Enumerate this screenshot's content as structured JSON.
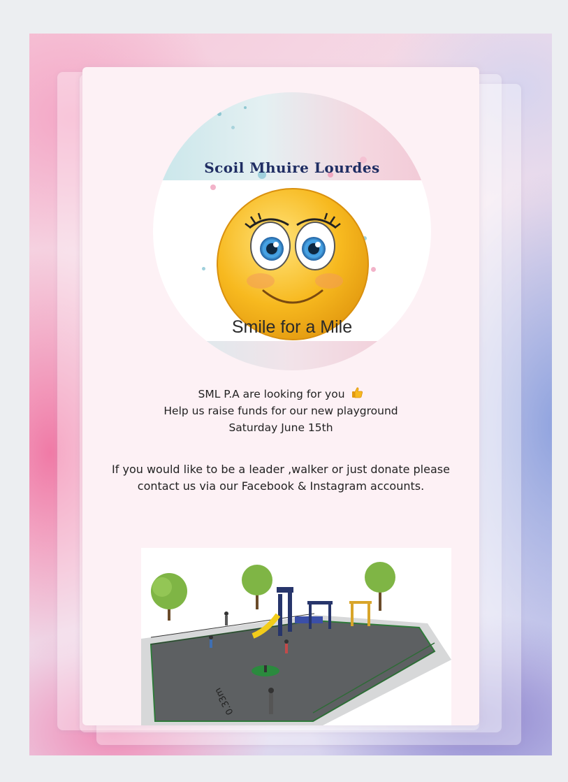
{
  "logo": {
    "school_name": "Scoil Mhuire Lourdes",
    "event_title": "Smile for a Mile"
  },
  "intro": {
    "line1": "SML P.A are looking for you",
    "line1_icon": "thumbs-up-emoji-icon",
    "line2": "Help us raise funds for our new playground",
    "line3": "Saturday June 15th"
  },
  "call_to_action": {
    "line1": "If you would like to be a leader ,walker or just donate please",
    "line2": "contact us via our Facebook & Instagram accounts."
  },
  "playground_image": {
    "dimension_label": "0.33m"
  },
  "colors": {
    "school_name": "#1f2d63",
    "text": "#222222",
    "smiley": "#f5b820"
  }
}
